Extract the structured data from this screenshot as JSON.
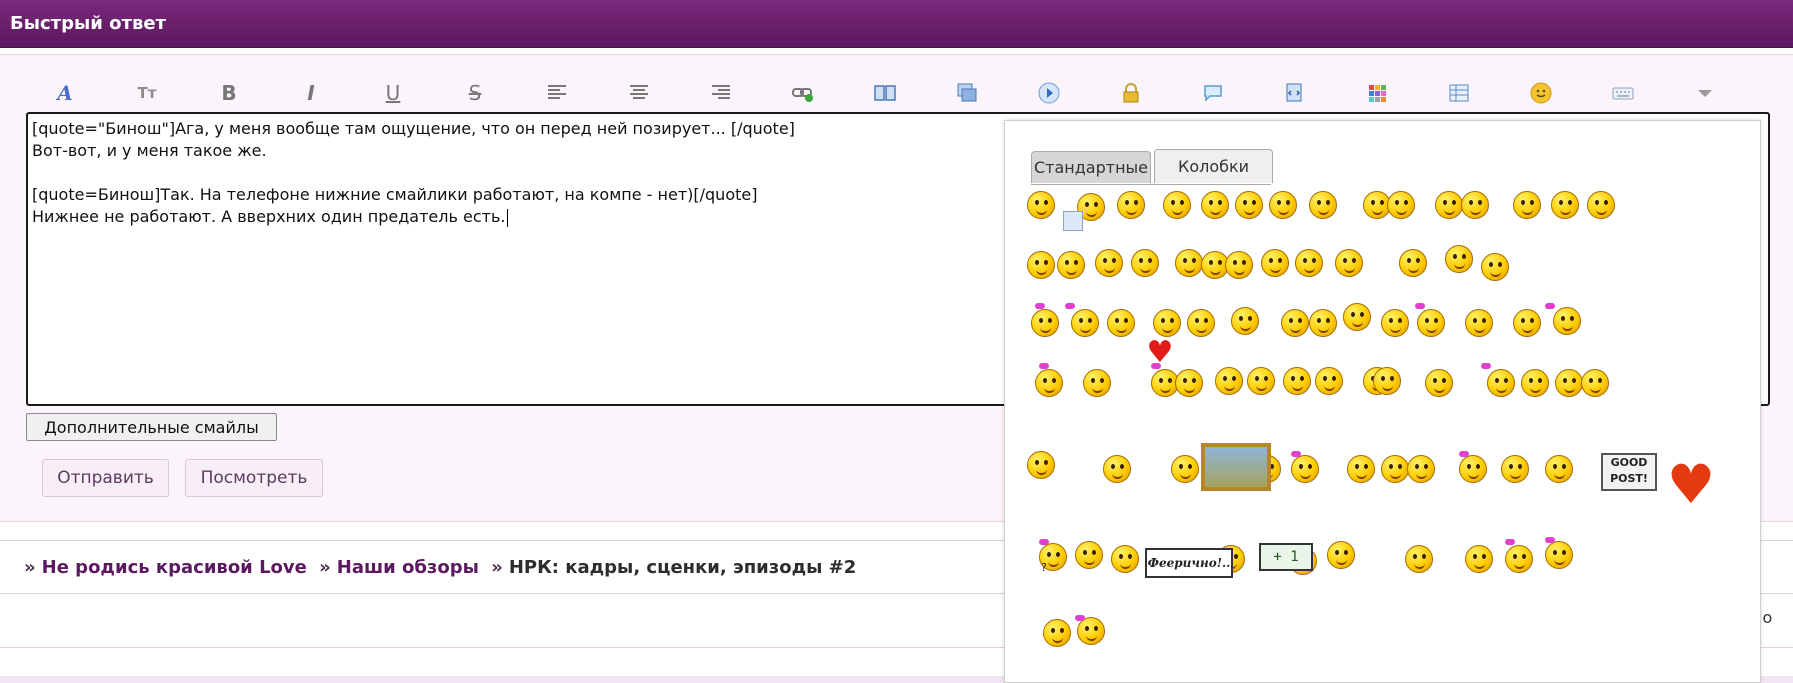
{
  "header": {
    "title": "Быстрый ответ",
    "bg_color": "#6a1f6d"
  },
  "toolbar": {
    "buttons": [
      {
        "name": "font-color",
        "icon": "font-color-icon",
        "glyph": "A"
      },
      {
        "name": "font-size",
        "icon": "font-size-icon",
        "glyph": "Tт"
      },
      {
        "name": "bold",
        "icon": "bold-icon",
        "glyph": "B"
      },
      {
        "name": "italic",
        "icon": "italic-icon",
        "glyph": "I"
      },
      {
        "name": "underline",
        "icon": "underline-icon",
        "glyph": "U"
      },
      {
        "name": "strike",
        "icon": "strikethrough-icon",
        "glyph": "S"
      },
      {
        "name": "align-left",
        "icon": "align-left-icon",
        "glyph": ""
      },
      {
        "name": "align-center",
        "icon": "align-center-icon",
        "glyph": ""
      },
      {
        "name": "align-right",
        "icon": "align-right-icon",
        "glyph": ""
      },
      {
        "name": "link",
        "icon": "link-icon",
        "glyph": ""
      },
      {
        "name": "book",
        "icon": "book-icon",
        "glyph": ""
      },
      {
        "name": "image",
        "icon": "image-icon",
        "glyph": ""
      },
      {
        "name": "play",
        "icon": "play-icon",
        "glyph": ""
      },
      {
        "name": "lock",
        "icon": "lock-icon",
        "glyph": ""
      },
      {
        "name": "quote",
        "icon": "speech-bubble-icon",
        "glyph": ""
      },
      {
        "name": "code",
        "icon": "code-icon",
        "glyph": ""
      },
      {
        "name": "colors",
        "icon": "color-grid-icon",
        "glyph": ""
      },
      {
        "name": "table",
        "icon": "table-icon",
        "glyph": ""
      },
      {
        "name": "smiley",
        "icon": "smiley-icon",
        "glyph": ""
      },
      {
        "name": "keyboard",
        "icon": "keyboard-icon",
        "glyph": ""
      },
      {
        "name": "more",
        "icon": "chevron-down-icon",
        "glyph": ""
      }
    ]
  },
  "editor": {
    "lines": [
      "[quote=\"Бинош\"]Ага, у меня вообще там ощущение, что он перед ней позирует... [/quote]",
      "Вот-вот, и у меня такое же.",
      "",
      "[quote=Бинош]Так. На телефоне нижние смайлики работают, на компе - нет)[/quote]",
      "Нижнее не работают. А вверхних один предатель есть."
    ]
  },
  "buttons": {
    "more_smilies": "Дополнительные смайлы",
    "send": "Отправить",
    "preview": "Посмотреть"
  },
  "breadcrumbs": {
    "sep": "»",
    "items": [
      "Не родись красивой Love",
      "Наши обзоры",
      "НРК: кадры, сценки, эпизоды #2"
    ]
  },
  "side_text": "но",
  "smiley_popup": {
    "tabs": [
      "Стандартные",
      "Колобки"
    ],
    "active_tab": "Колобки",
    "good_post_sign": "GOOD POST!",
    "feerichno_sign": "Феерично!..",
    "plus_one_sign": "+ 1",
    "qmark": "?"
  }
}
